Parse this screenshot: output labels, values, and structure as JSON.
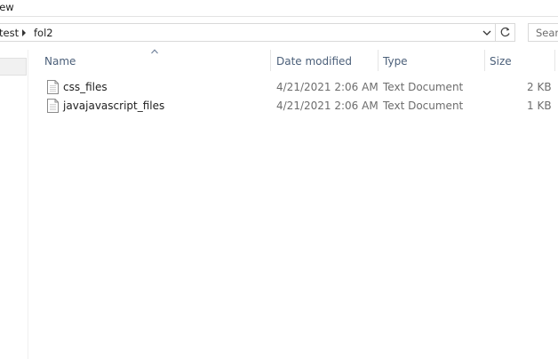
{
  "ribbon": {
    "tab_partial": "iew"
  },
  "address_bar": {
    "crumbs": [
      "test",
      "fol2"
    ]
  },
  "search": {
    "placeholder_partial": "Searc"
  },
  "columns": {
    "name": "Name",
    "date_modified": "Date modified",
    "type": "Type",
    "size": "Size"
  },
  "files": [
    {
      "name": "css_files",
      "date_modified": "4/21/2021 2:06 AM",
      "type": "Text Document",
      "size": "2 KB",
      "icon": "text-file-icon"
    },
    {
      "name": "javajavascript_files",
      "date_modified": "4/21/2021 2:06 AM",
      "type": "Text Document",
      "size": "1 KB",
      "icon": "text-file-icon"
    }
  ]
}
